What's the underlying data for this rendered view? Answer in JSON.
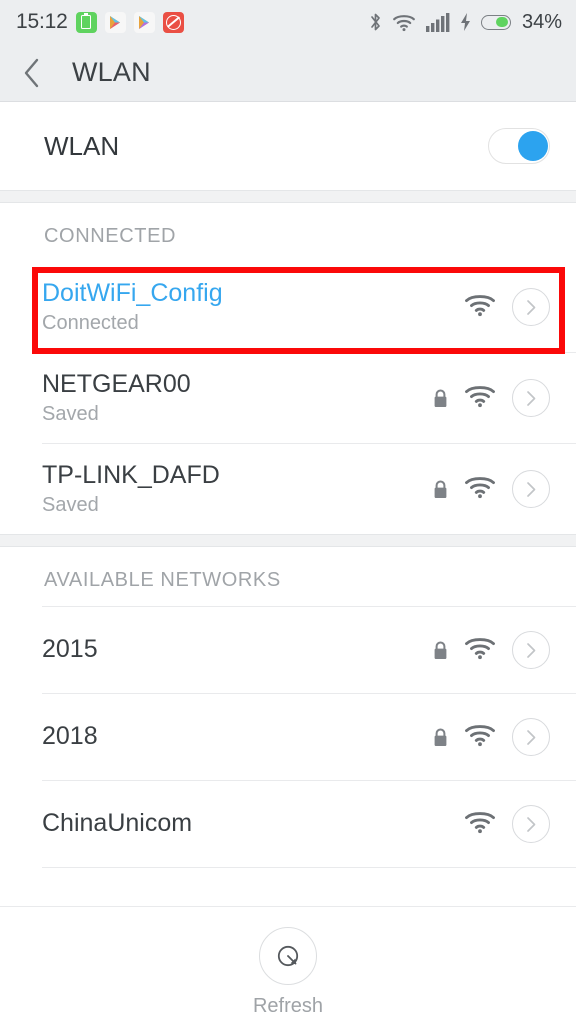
{
  "status_bar": {
    "time": "15:12",
    "battery_percent": "34%",
    "left_icons": [
      "battery-app-icon",
      "play-store-icon",
      "play-store-icon",
      "no-entry-icon"
    ],
    "right_icons": [
      "bluetooth-icon",
      "wifi-icon",
      "cellular-signal-icon",
      "charging-bolt-icon",
      "battery-icon"
    ],
    "battery_fill_color": "#5fd35f",
    "background_color": "#eceef0"
  },
  "header": {
    "back_icon": "chevron-left-icon",
    "title": "WLAN"
  },
  "wlan_toggle": {
    "label": "WLAN",
    "state": "on",
    "knob_color": "#2ca3ef"
  },
  "sections": [
    {
      "title": "CONNECTED",
      "networks": [
        {
          "ssid": "DoitWiFi_Config",
          "status": "Connected",
          "secured": false,
          "highlighted": true,
          "ssid_color": "#36a7ef",
          "signal": "full"
        },
        {
          "ssid": "NETGEAR00",
          "status": "Saved",
          "secured": true,
          "highlighted": false,
          "signal": "full"
        },
        {
          "ssid": "TP-LINK_DAFD",
          "status": "Saved",
          "secured": true,
          "highlighted": false,
          "signal": "full"
        }
      ]
    },
    {
      "title": "AVAILABLE NETWORKS",
      "networks": [
        {
          "ssid": "2015",
          "status": "",
          "secured": true,
          "highlighted": false,
          "signal": "full"
        },
        {
          "ssid": "2018",
          "status": "",
          "secured": true,
          "highlighted": false,
          "signal": "full"
        },
        {
          "ssid": "ChinaUnicom",
          "status": "",
          "secured": false,
          "highlighted": false,
          "signal": "full"
        }
      ]
    }
  ],
  "footer": {
    "refresh_icon": "refresh-scan-icon",
    "refresh_label": "Refresh"
  },
  "annotation": {
    "type": "highlight-rectangle",
    "color": "#fb0909",
    "target": "DoitWiFi_Config"
  }
}
